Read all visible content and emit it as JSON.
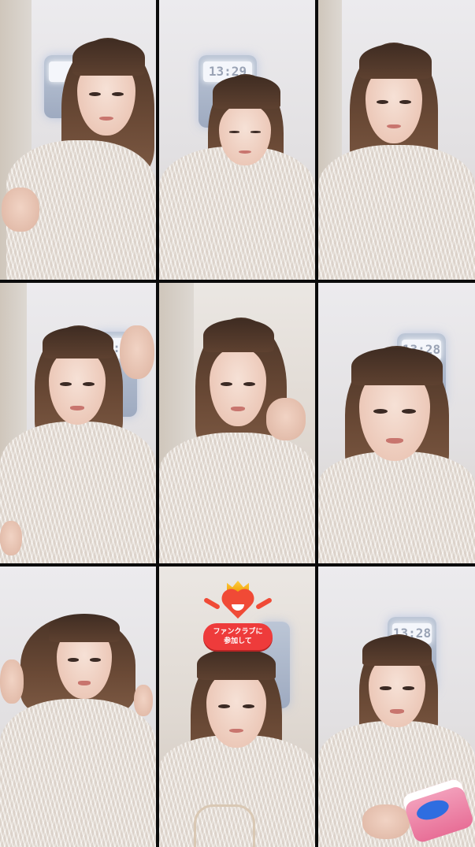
{
  "layout": {
    "kind": "multi-guest live video grid",
    "rows": 3,
    "columns": 3,
    "divider_color": "#0b0b0b"
  },
  "tiles": [
    {
      "id": "tile-1",
      "clock_digits": "",
      "sticker": false
    },
    {
      "id": "tile-2",
      "clock_digits": "13:29",
      "sticker": false
    },
    {
      "id": "tile-3",
      "clock_digits": "",
      "sticker": false
    },
    {
      "id": "tile-4",
      "clock_digits": "13:28",
      "sticker": false
    },
    {
      "id": "tile-5",
      "clock_digits": "",
      "sticker": false
    },
    {
      "id": "tile-6",
      "clock_digits": "13:28",
      "sticker": false
    },
    {
      "id": "tile-7",
      "clock_digits": "",
      "sticker": false
    },
    {
      "id": "tile-8",
      "clock_digits": "",
      "sticker": true
    },
    {
      "id": "tile-9",
      "clock_digits": "13:28",
      "sticker": false
    }
  ],
  "sticker": {
    "line1": "ファンクラブに",
    "line2": "参加して",
    "colors": {
      "bubble": "#ee3b3b",
      "heart": "#f04a36",
      "crown": "#f1a20b"
    }
  },
  "colors": {
    "sweater": "#ebe4dc",
    "hair": "#4a3427",
    "wall": "#e6e4e6",
    "tub": "#e86f97"
  }
}
